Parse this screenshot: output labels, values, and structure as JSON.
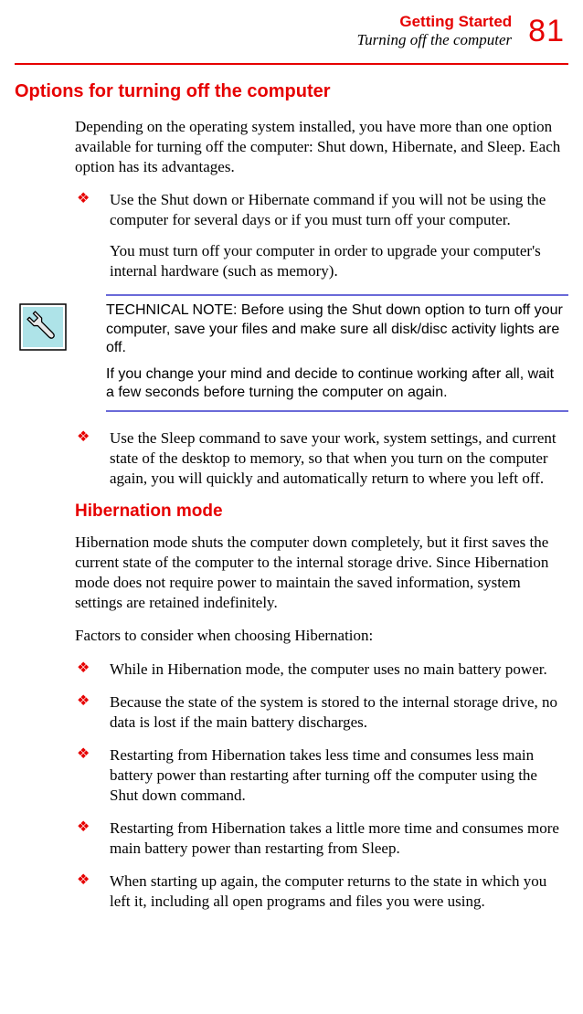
{
  "header": {
    "chapter": "Getting Started",
    "section": "Turning off the computer",
    "page": "81"
  },
  "h1": "Options for turning off the computer",
  "intro": "Depending on the operating system installed, you have more than one option available for turning off the computer: Shut down, Hibernate, and Sleep. Each option has its advantages.",
  "bullets1": [
    {
      "main": "Use the Shut down or Hibernate command if you will not be using the computer for several days or if you must turn off your computer.",
      "sub": "You must turn off your computer in order to upgrade your computer's internal hardware (such as memory)."
    }
  ],
  "note": {
    "p1": "TECHNICAL NOTE: Before using the Shut down option to turn off your computer, save your files and make sure all disk/disc activity lights are off.",
    "p2": "If you change your mind and decide to continue working after all, wait a few seconds before turning the computer on again."
  },
  "bullets2": [
    "Use the Sleep command to save your work, system settings, and current state of the desktop to memory, so that when you turn on the computer again, you will quickly and automatically return to where you left off."
  ],
  "h2": "Hibernation mode",
  "hib_intro": "Hibernation mode shuts the computer down completely, but it first saves the current state of the computer to the internal storage drive. Since Hibernation mode does not require power to maintain the saved information, system settings are retained indefinitely.",
  "hib_lead": "Factors to consider when choosing Hibernation:",
  "hib_bullets": [
    "While in Hibernation mode, the computer uses no main battery power.",
    "Because the state of the system is stored to the internal storage drive, no data is lost if the main battery discharges.",
    "Restarting from Hibernation takes less time and consumes less main battery power than restarting after turning off the computer using the Shut down command.",
    "Restarting from Hibernation takes a little more time and consumes more main battery power than restarting from Sleep.",
    "When starting up again, the computer returns to the state in which you left it, including all open programs and files you were using."
  ]
}
